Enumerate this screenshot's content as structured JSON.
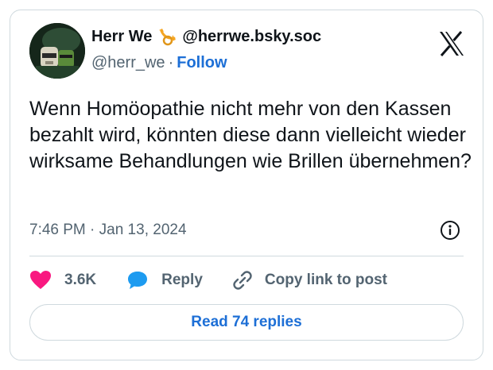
{
  "author": {
    "display_name": "Herr We",
    "badge_icon": "horn-icon",
    "alt_handle": "@herrwe.bsky.soc",
    "handle": "@herr_we",
    "separator": "·",
    "follow_label": "Follow"
  },
  "brand_icon": "x-logo-icon",
  "tweet": {
    "text": "Wenn Homöopathie nicht mehr von den Kassen bezahlt wird, könnten diese dann vielleicht wieder wirksame Behandlungen wie Brillen übernehmen?",
    "timestamp": "7:46 PM · Jan 13, 2024"
  },
  "actions": {
    "like_count": "3.6K",
    "reply_label": "Reply",
    "copy_link_label": "Copy link to post"
  },
  "read_replies_label": "Read 74 replies",
  "colors": {
    "accent": "#1d6fd6",
    "like": "#f91880",
    "reply": "#1d9bf0",
    "muted": "#536471",
    "border": "#cfd9de"
  }
}
